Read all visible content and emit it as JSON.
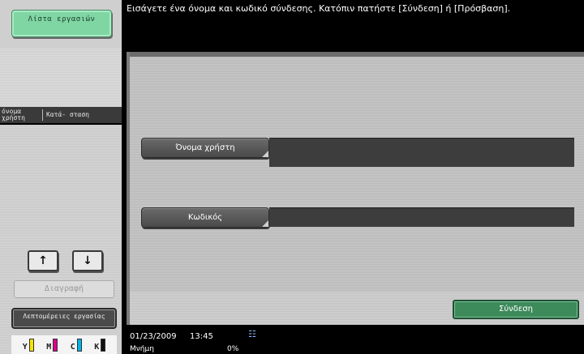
{
  "sidebar": {
    "job_list_label": "Λίστα εργασιών",
    "header": {
      "col1": "όνομα χρήστη",
      "col2": "Κατά- σταση"
    },
    "up_label": "↑",
    "down_label": "↓",
    "delete_label": "Διαγραφή",
    "details_label": "Λεπτομέρειες εργασίας",
    "toners": [
      "Y",
      "M",
      "C",
      "K"
    ]
  },
  "message": "Εισάγετε ένα όνομα και κωδικό σύνδεσης. Κατόπιν πατήστε [Σύνδεση] ή [Πρόσβαση].",
  "form": {
    "username_label": "Όνομα χρήστη",
    "username_value": "",
    "password_label": "Κωδικός",
    "password_value": ""
  },
  "login_label": "Σύνδεση",
  "status": {
    "date": "01/23/2009",
    "time": "13:45",
    "icon": "network-icon",
    "memory_label": "Μνήμη",
    "memory_value": "0%"
  },
  "colors": {
    "accent_green": "#7fd6a3",
    "login_green": "#3d8a5a",
    "panel_gray": "#c8c8c8",
    "field_dark": "#3d3d3d"
  }
}
